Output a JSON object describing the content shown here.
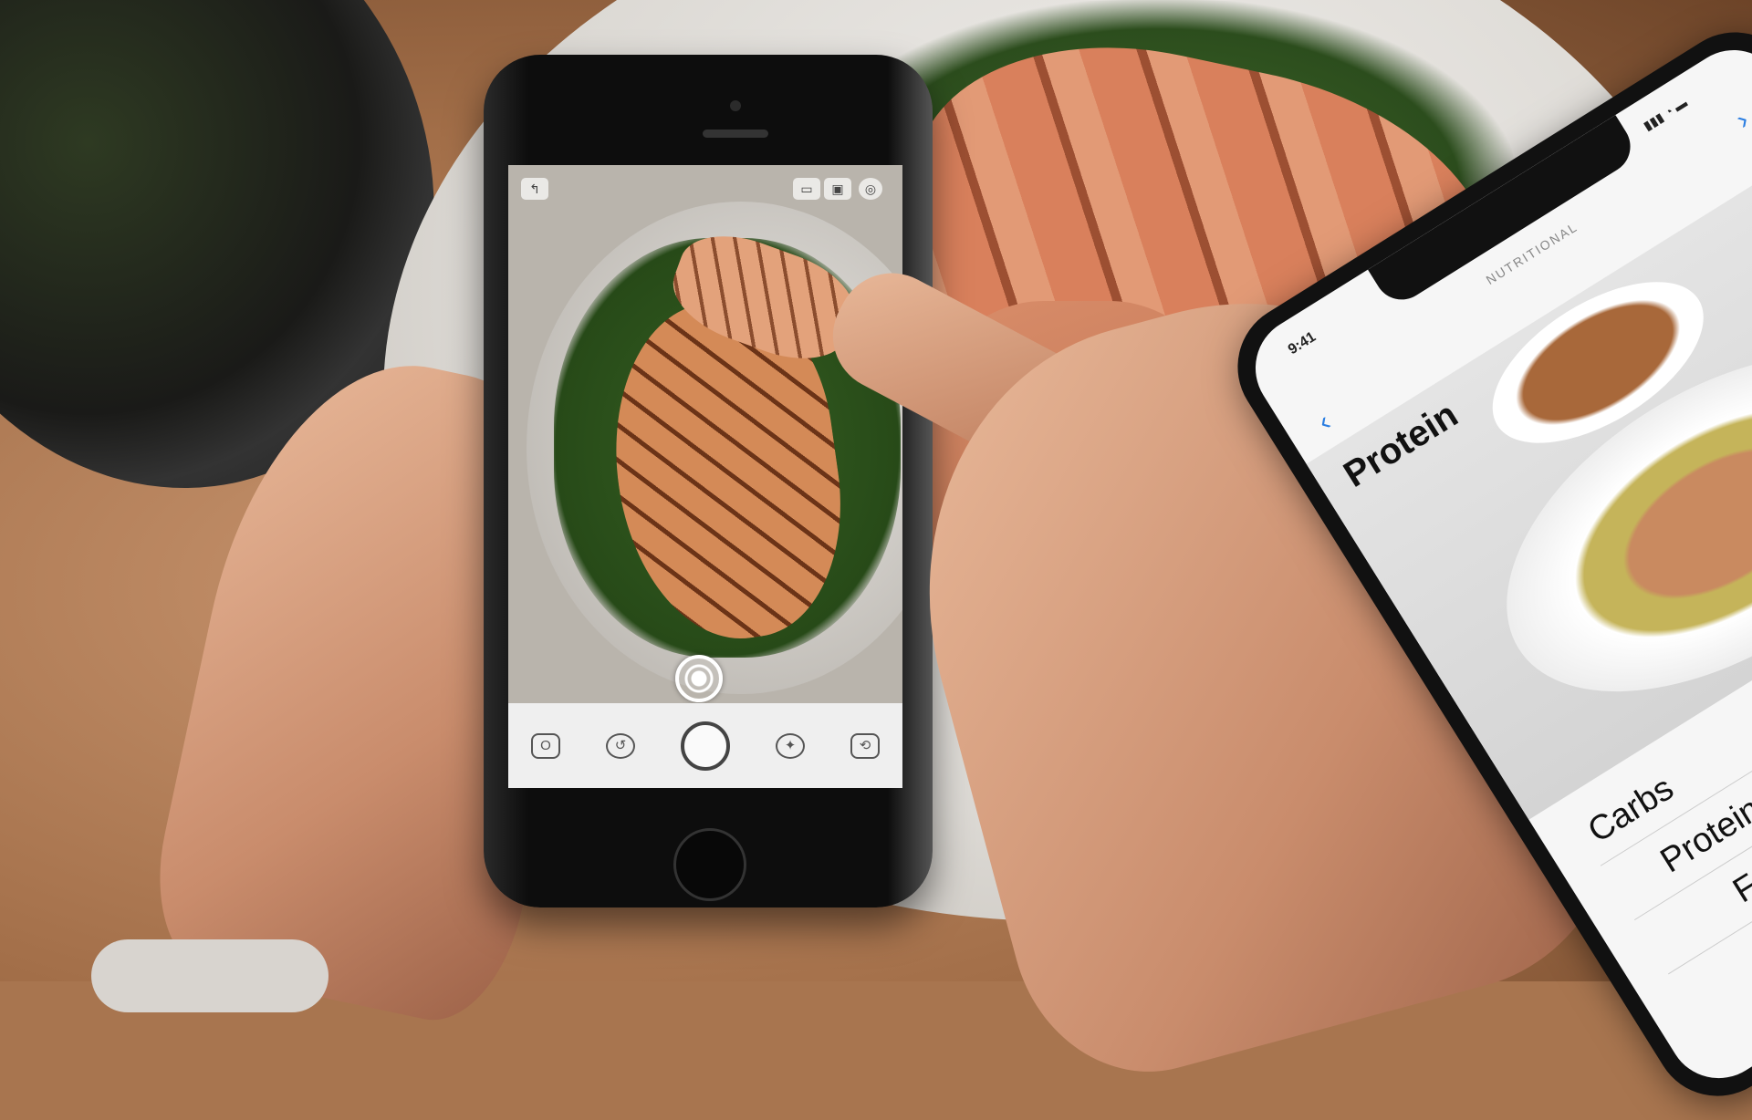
{
  "left_phone": {
    "camera_bar_icons": [
      "photo-icon",
      "timer-icon",
      "shutter-button",
      "flash-icon",
      "flip-camera-icon"
    ],
    "top_icons": [
      "back-icon",
      "aspect-icon",
      "hdr-icon",
      "settings-icon"
    ],
    "icon_glyphs": {
      "back": "↰",
      "aspect": "▭",
      "hdr": "▣",
      "settings": "◎",
      "photo": "O",
      "timer": "↺",
      "flash": "✦",
      "flip": "⟲"
    }
  },
  "right_phone": {
    "status_time": "9:41",
    "status_icons": "▮▮▮ ◔ ▬",
    "nav_title": "NUTRITIONAL",
    "back_glyph": "‹",
    "forward_glyph": "›",
    "hero_title": "Protein",
    "macros": [
      "Carbs",
      "Protein",
      "Fat"
    ],
    "accent": "#2a7de1"
  }
}
